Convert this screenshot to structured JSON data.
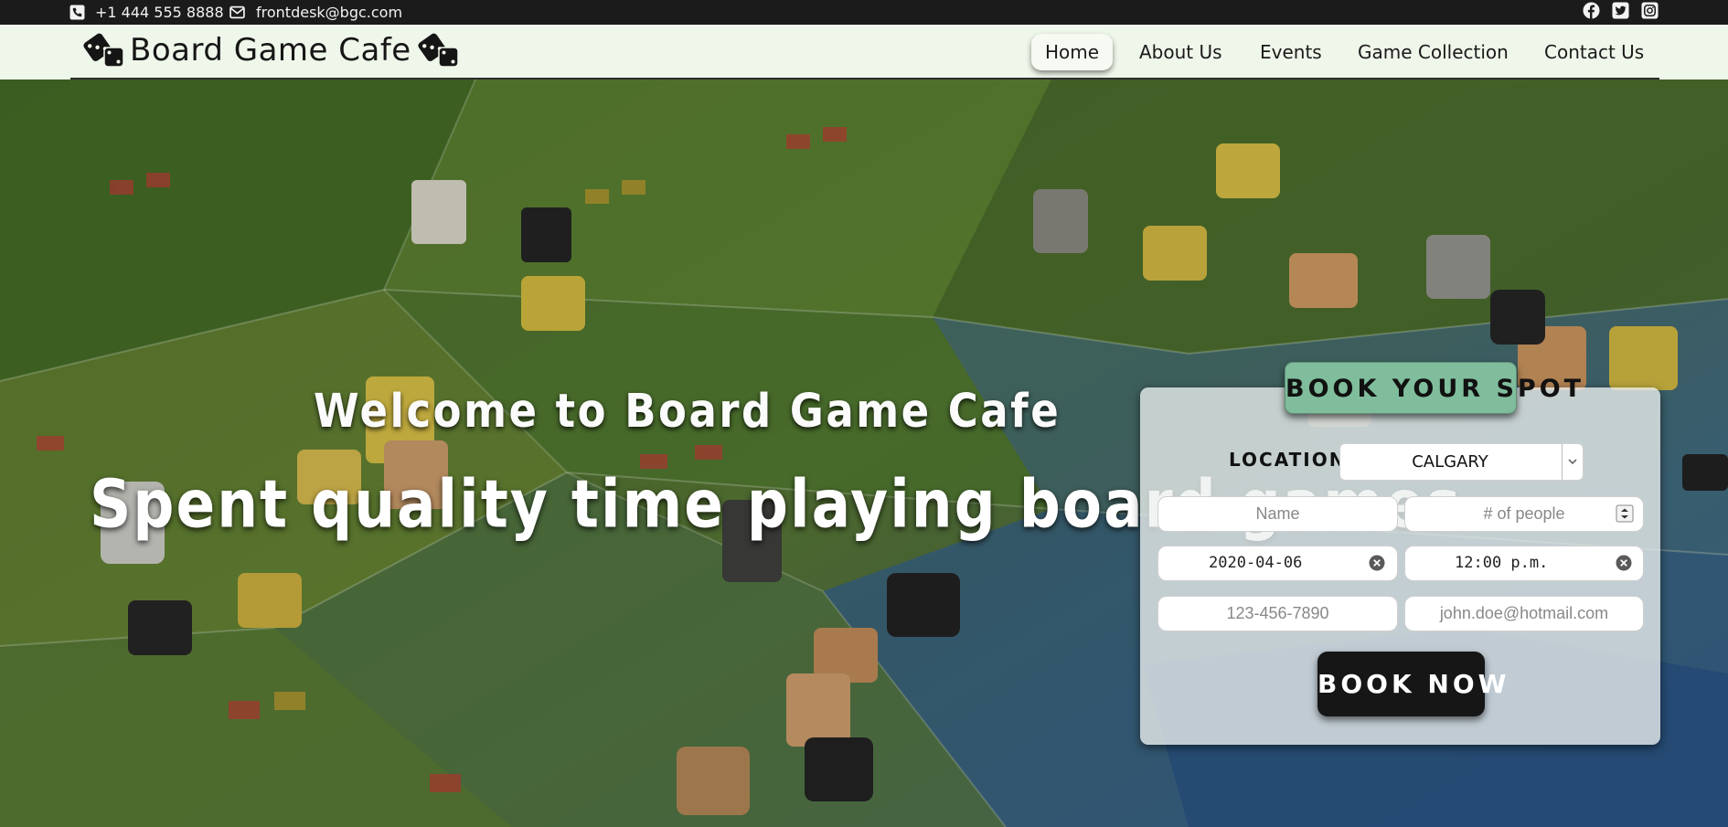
{
  "topbar": {
    "phone": "+1 444 555 8888",
    "email": "frontdesk@bgc.com",
    "social": [
      "facebook-icon",
      "twitter-icon",
      "instagram-icon"
    ]
  },
  "brand": {
    "name": "Board Game Cafe",
    "icon": "dice-icon"
  },
  "nav": {
    "items": [
      {
        "label": "Home",
        "active": true
      },
      {
        "label": "About Us",
        "active": false
      },
      {
        "label": "Events",
        "active": false
      },
      {
        "label": "Game Collection",
        "active": false
      },
      {
        "label": "Contact Us",
        "active": false
      }
    ]
  },
  "hero": {
    "welcome": "Welcome to Board Game Cafe",
    "tagline": "Spent quality time playing board games"
  },
  "booking": {
    "title": "BOOK YOUR SPOT",
    "location_label": "LOCATION:",
    "location_value": "CALGARY",
    "name_placeholder": "Name",
    "people_placeholder": "# of people",
    "date_value": "2020-04-06",
    "time_value": "12:00 p.m.",
    "phone_placeholder": "123-456-7890",
    "email_placeholder": "john.doe@hotmail.com",
    "submit_label": "BOOK NOW"
  },
  "colors": {
    "topbar_bg": "#1b1b1b",
    "navbar_bg": "#eff6ea",
    "badge_bg": "#7fbd9c",
    "button_bg": "#161616"
  }
}
